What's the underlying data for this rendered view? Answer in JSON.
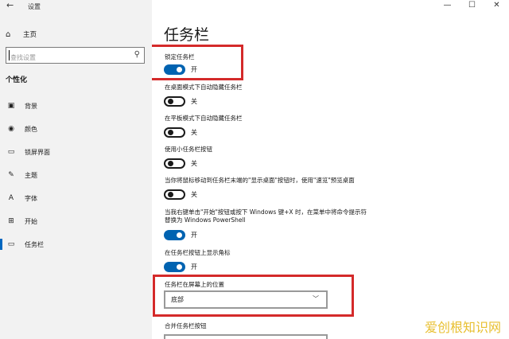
{
  "window": {
    "back_glyph": "←",
    "title": "设置",
    "controls": {
      "minimize": "—",
      "maximize": "☐",
      "close": "✕"
    }
  },
  "sidebar": {
    "home_label": "主页",
    "home_icon": "home-icon",
    "search_placeholder": "查找设置",
    "section_title": "个性化",
    "items": [
      {
        "label": "背景",
        "icon": "image-icon",
        "glyph": "▣"
      },
      {
        "label": "颜色",
        "icon": "palette-icon",
        "glyph": "◉"
      },
      {
        "label": "锁屏界面",
        "icon": "lockscreen-icon",
        "glyph": "▭"
      },
      {
        "label": "主题",
        "icon": "theme-icon",
        "glyph": "✎"
      },
      {
        "label": "字体",
        "icon": "font-icon",
        "glyph": "A"
      },
      {
        "label": "开始",
        "icon": "start-icon",
        "glyph": "⊞"
      },
      {
        "label": "任务栏",
        "icon": "taskbar-icon",
        "glyph": "▭",
        "selected": true
      }
    ]
  },
  "main": {
    "page_title": "任务栏",
    "settings": [
      {
        "label": "锁定任务栏",
        "state": "on",
        "state_text": "开"
      },
      {
        "label": "在桌面模式下自动隐藏任务栏",
        "state": "off",
        "state_text": "关"
      },
      {
        "label": "在平板模式下自动隐藏任务栏",
        "state": "off",
        "state_text": "关"
      },
      {
        "label": "使用小任务栏按钮",
        "state": "off",
        "state_text": "关"
      },
      {
        "label": "当你将鼠标移动到任务栏末端的\"显示桌面\"按钮时，使用\"速览\"预览桌面",
        "state": "off",
        "state_text": "关"
      },
      {
        "label": "当我右键单击\"开始\"按钮或按下 Windows 键+X 时，在菜单中将命令提示符替换为 Windows PowerShell",
        "state": "on",
        "state_text": "开"
      },
      {
        "label": "在任务栏按钮上显示角标",
        "state": "on",
        "state_text": "开"
      }
    ],
    "position": {
      "label": "任务栏在屏幕上的位置",
      "value": "底部"
    },
    "combine": {
      "label": "合并任务栏按钮"
    }
  },
  "watermark": "爱创根知识网",
  "colors": {
    "accent": "#0063b1",
    "highlight": "#d42a2a",
    "sidebar_bg": "#f2f2f2"
  }
}
